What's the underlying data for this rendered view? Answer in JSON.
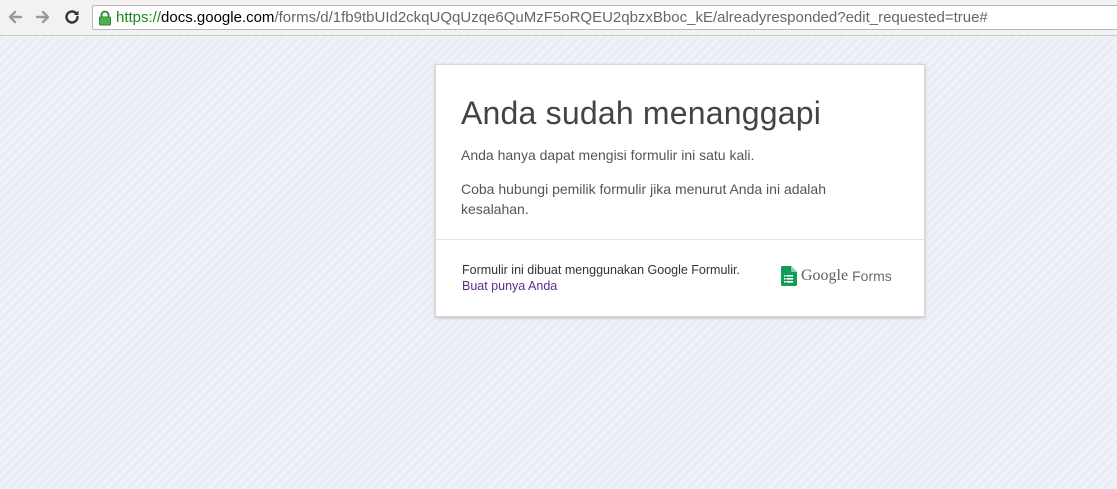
{
  "browser": {
    "url_scheme": "https://",
    "url_host": "docs.google.com",
    "url_path": "/forms/d/1fb9tbUId2ckqUQqUzqe6QuMzF5oRQEU2qbzxBboc_kE/alreadyresponded?edit_requested=true#"
  },
  "card": {
    "title": "Anda sudah menanggapi",
    "message1": "Anda hanya dapat mengisi formulir ini satu kali.",
    "message2": "Coba hubungi pemilik formulir jika menurut Anda ini adalah kesalahan."
  },
  "footer": {
    "text": "Formulir ini dibuat menggunakan Google Formulir.",
    "link_label": "Buat punya Anda",
    "logo_google": "Google",
    "logo_forms": "Forms"
  },
  "colors": {
    "forms_green": "#0f9d58",
    "link_purple": "#5b2c8f",
    "secure_green": "#1a8a1a"
  },
  "icons": {
    "back": "arrow-left-icon",
    "forward": "arrow-right-icon",
    "reload": "reload-icon",
    "secure": "lock-icon",
    "forms": "google-forms-icon"
  }
}
